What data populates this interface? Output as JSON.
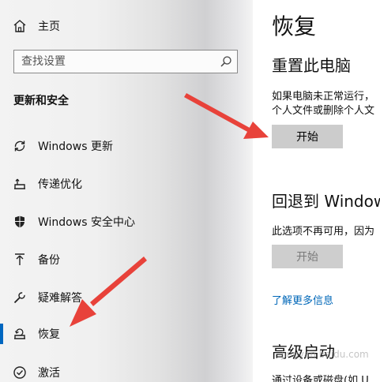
{
  "sidebar": {
    "home": "主页",
    "search_placeholder": "查找设置",
    "section_title": "更新和安全",
    "items": [
      {
        "label": "Windows 更新",
        "icon": "sync-icon"
      },
      {
        "label": "传递优化",
        "icon": "delivery-optimization-icon"
      },
      {
        "label": "Windows 安全中心",
        "icon": "shield-icon"
      },
      {
        "label": "备份",
        "icon": "backup-arrow-icon"
      },
      {
        "label": "疑难解答",
        "icon": "wrench-icon"
      },
      {
        "label": "恢复",
        "icon": "recovery-icon",
        "active": true
      },
      {
        "label": "激活",
        "icon": "activation-check-icon"
      }
    ]
  },
  "main": {
    "title": "恢复",
    "reset": {
      "heading": "重置此电脑",
      "desc_line1": "如果电脑未正常运行，",
      "desc_line2": "个人文件或删除个人文",
      "button": "开始"
    },
    "rollback": {
      "heading": "回退到 Windows",
      "desc": "此选项不再可用，因为",
      "button": "开始"
    },
    "learn_more": "了解更多信息",
    "advanced": {
      "heading": "高级启动",
      "desc": "通过设备或磁盘(如 U"
    }
  },
  "watermark": "jingyan.baidu.com",
  "colors": {
    "accent": "#0067c0",
    "link": "#0067b8",
    "arrow": "#e8423a",
    "button": "#cccccc"
  }
}
